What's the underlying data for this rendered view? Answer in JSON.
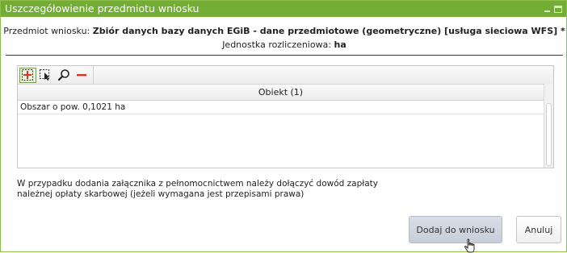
{
  "dialog": {
    "title": "Uszczegółowienie przedmiotu wniosku",
    "controls": [
      "minimize-icon",
      "maximize-icon"
    ]
  },
  "subject": {
    "label": "Przedmiot wniosku:",
    "value": "Zbiór danych bazy danych EGiB - dane przedmiotowe (geometryczne) [usługa sieciowa WFS] *"
  },
  "unit": {
    "label": "Jednostka rozliczeniowa:",
    "value": "ha"
  },
  "toolbar": {
    "buttons": [
      "add-area-icon",
      "select-area-icon",
      "zoom-icon",
      "remove-icon"
    ]
  },
  "grid": {
    "column_header": "Obiekt (1)",
    "rows": [
      "Obszar o pow. 0,1021 ha"
    ]
  },
  "note": {
    "line1": "W przypadku dodania załącznika z pełnomocnictwem należy dołączyć dowód zapłaty",
    "line2": "należnej opłaty skarbowej (jeżeli wymagana jest przepisami prawa)"
  },
  "actions": {
    "add_label": "Dodaj do wniosku",
    "cancel_label": "Anuluj"
  },
  "colors": {
    "titlebar": "#73ad35",
    "remove_icon": "#d9342b"
  }
}
